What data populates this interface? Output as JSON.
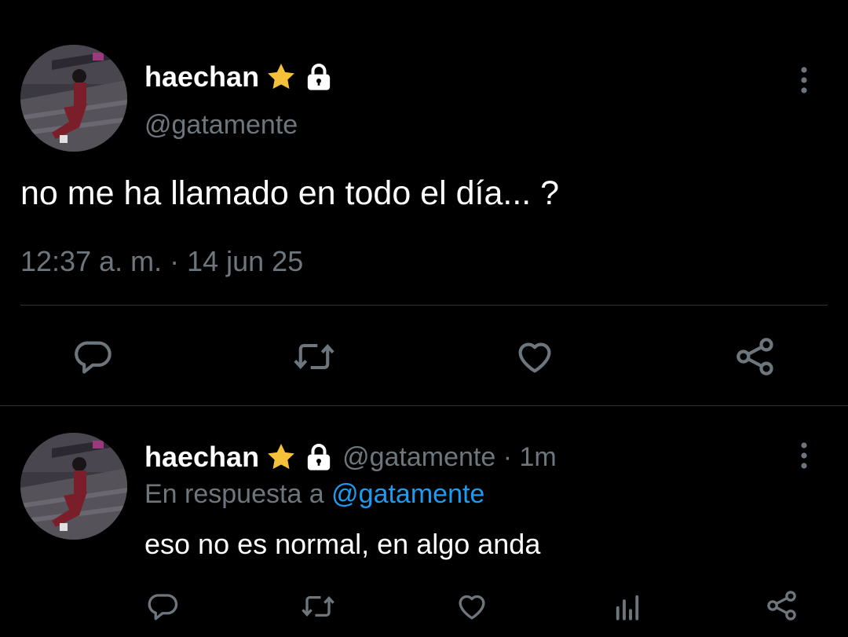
{
  "main_tweet": {
    "display_name": "haechan",
    "handle": "@gatamente",
    "text": "no me ha llamado en todo el día... ?",
    "timestamp": "12:37 a. m. · 14 jun 25",
    "star_badge_icon": "star-icon",
    "lock_badge_icon": "lock-icon",
    "more_icon": "more-vertical-icon",
    "actions": [
      "reply-icon",
      "retweet-icon",
      "like-icon",
      "share-icon"
    ]
  },
  "reply_tweet": {
    "display_name": "haechan",
    "handle_time": "@gatamente · 1m",
    "reply_prefix": "En respuesta a",
    "reply_to": "@gatamente",
    "text": "eso no es normal, en algo anda",
    "actions": [
      "reply-icon",
      "retweet-icon",
      "like-icon",
      "analytics-icon",
      "share-icon"
    ]
  },
  "colors": {
    "background": "#000000",
    "text": "#e7e9ea",
    "muted": "#6e767d",
    "link": "#1d9bf0",
    "star": "#f5c13b"
  }
}
